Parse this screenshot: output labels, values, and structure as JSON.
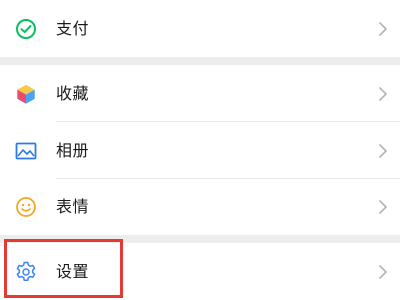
{
  "menu": {
    "pay": {
      "label": "支付",
      "icon": "pay-icon"
    },
    "favorites": {
      "label": "收藏",
      "icon": "favorites-cube-icon"
    },
    "album": {
      "label": "相册",
      "icon": "album-picture-icon"
    },
    "stickers": {
      "label": "表情",
      "icon": "smiley-face-icon"
    },
    "settings": {
      "label": "设置",
      "icon": "gear-icon"
    }
  },
  "colors": {
    "pay_icon": "#07c160",
    "album_icon": "#2c7be5",
    "sticker_icon": "#f5a623",
    "settings_icon": "#3d86f5",
    "highlight_border": "#e53935",
    "chevron": "#b2b2b2"
  },
  "highlight": {
    "target": "settings"
  }
}
